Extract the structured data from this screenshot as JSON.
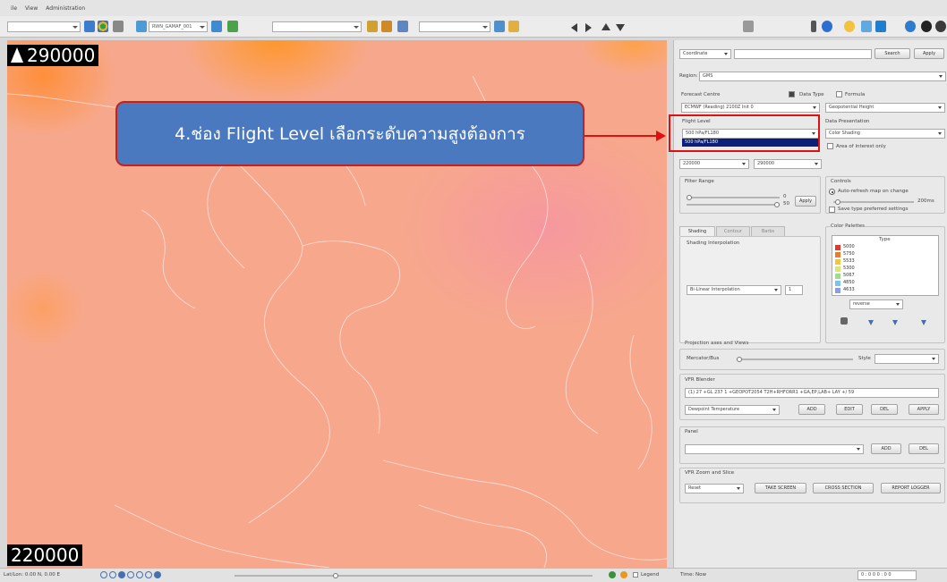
{
  "menu": {
    "items": [
      "ile",
      "View",
      "Administration"
    ]
  },
  "toolbar": {
    "combo1": "",
    "combo2": "RWN_GAMAF_001",
    "combo3": "",
    "combo4": ""
  },
  "map": {
    "top_scale": "290000",
    "bottom_scale": "220000",
    "colors": {
      "background": "#f7a88c",
      "top_hot": "#ff9628",
      "pink": "#f696a0"
    }
  },
  "statusbar": {
    "left_text": "Lat/Lon: 0.00 N, 0.00 E",
    "legend_label": "Legend",
    "cursor_text": "Time: Now",
    "right_text": "0 : 0 0 0 : 0 0"
  },
  "panel": {
    "search_mode": "Coordinate",
    "search_input": "",
    "search_button": "Search",
    "apply_button": "Apply",
    "region_label": "Region:",
    "region_value": "GMS",
    "forecast_centre_label": "Forecast Centre",
    "data_type_label": "Data Type",
    "formula_label": "Formula",
    "forecast_centre_value": "ECMWF (Reading) 2100Z Init 0",
    "data_type_value": "Geopotential Height",
    "flight_level_label": "Flight Level",
    "flight_level_value": "500 hPa/FL180",
    "flight_level_highlight": "500 hPa/FL180",
    "data_presentation_label": "Data Presentation",
    "data_presentation_value": "Color Shading",
    "area_interest_label": "Area of interest only",
    "range_min": "220000",
    "range_max": "290000",
    "filter_range_label": "Filter Range",
    "filter_min": "0",
    "filter_max": "50",
    "filter_apply": "Apply",
    "controls_label": "Controls",
    "auto_refresh_label": "Auto-refresh map on change",
    "refresh_value": "200ms",
    "save_type_label": "Save type preferred settings",
    "tabs": [
      "Shading",
      "Contour",
      "Barbs"
    ],
    "shading_interp_label": "Shading Interpolation",
    "interp_value": "Bi-Linear Interpolation",
    "interp_number": "1",
    "color_palettes_label": "Color Palettes",
    "palette_header": "Type",
    "palette_entries": [
      "5000",
      "5750",
      "5533",
      "5300",
      "5067",
      "4850",
      "4633"
    ],
    "palette_colors": [
      "#e03a2c",
      "#f07a2a",
      "#f3c63a",
      "#d9e86a",
      "#9fdc8e",
      "#7cc4e8",
      "#8a9fe0"
    ],
    "palette_combo": "reverse",
    "projection_label": "Projection axes and Views",
    "mercator_label": "Mercator/Bus",
    "style_label": "Style",
    "style_value": "",
    "vfr_label": "VFR Blender",
    "vfr_value": "(1) 27 +GL 237 1 +GEOPOT2054 T2H+RHFORR1 +GA,EP,LAB+ LAY +/ 59",
    "vfr_combo": "Dewpoint Temperature",
    "vfr_add": "ADD",
    "vfr_edit": "EDIT",
    "vfr_del": "DEL",
    "vfr_apply": "APPLY",
    "panel_label": "Panel",
    "panel_combo": "",
    "panel_add": "ADD",
    "panel_del": "DEL",
    "zoom_label": "VFR Zoom and Slice",
    "zoom_combo": "Reset",
    "take_screen": "TAKE SCREEN",
    "cross_section": "CROSS SECTION",
    "report_logger": "REPORT LOGGER"
  },
  "annotation": {
    "text": "4.ช่อง Flight Level เลือกระดับความสูงต้องการ",
    "box_color": "#4b79c0",
    "highlight_color": "#e01010"
  }
}
